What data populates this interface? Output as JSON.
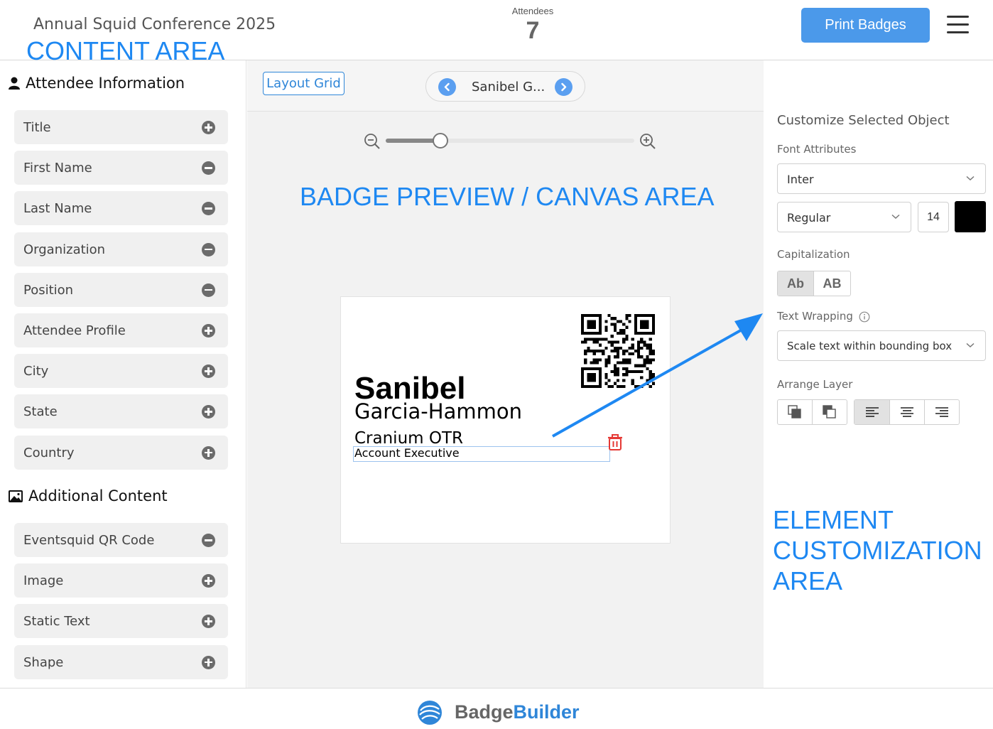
{
  "header": {
    "conference_title": "Annual Squid Conference 2025",
    "annotation": "CONTENT AREA",
    "attendees_label": "Attendees",
    "attendees_count": "7",
    "print_label": "Print Badges"
  },
  "sidebar": {
    "attendee_section": "Attendee Information",
    "attendee_fields": [
      {
        "label": "Title",
        "state": "add"
      },
      {
        "label": "First Name",
        "state": "remove"
      },
      {
        "label": "Last Name",
        "state": "remove"
      },
      {
        "label": "Organization",
        "state": "remove"
      },
      {
        "label": "Position",
        "state": "remove"
      },
      {
        "label": "Attendee Profile",
        "state": "add"
      },
      {
        "label": "City",
        "state": "add"
      },
      {
        "label": "State",
        "state": "add"
      },
      {
        "label": "Country",
        "state": "add"
      }
    ],
    "additional_section": "Additional Content",
    "additional_fields": [
      {
        "label": "Eventsquid QR Code",
        "state": "remove"
      },
      {
        "label": "Image",
        "state": "add"
      },
      {
        "label": "Static Text",
        "state": "add"
      },
      {
        "label": "Shape",
        "state": "add"
      }
    ]
  },
  "canvas": {
    "layout_grid_label": "Layout Grid",
    "current_attendee": "Sanibel G...",
    "zoom_level": 0.22,
    "annotation": "BADGE PREVIEW / CANVAS AREA",
    "badge": {
      "first_name": "Sanibel",
      "last_name": "Garcia-Hammon",
      "organization": "Cranium OTR",
      "position": "Account Executive"
    }
  },
  "panel": {
    "title": "Customize Selected Object",
    "font_attributes_label": "Font Attributes",
    "font_family": "Inter",
    "font_weight": "Regular",
    "font_size": "14",
    "font_color": "#000000",
    "capitalization_label": "Capitalization",
    "capitalization_options": [
      "Ab",
      "AB"
    ],
    "text_wrapping_label": "Text Wrapping",
    "text_wrapping_value": "Scale text within bounding box",
    "arrange_layer_label": "Arrange Layer",
    "annotation": "ELEMENT CUSTOMIZATION AREA"
  },
  "footer": {
    "brand_part1": "Badge",
    "brand_part2": "Builder"
  },
  "colors": {
    "accent": "#4b99ea",
    "annotation": "#1e88f2",
    "delete": "#e53935"
  }
}
